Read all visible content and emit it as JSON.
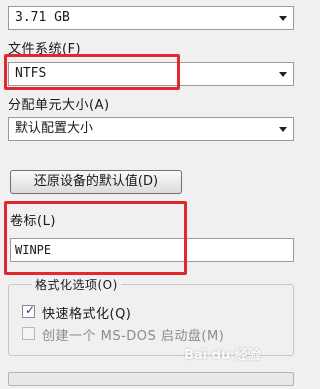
{
  "capacity": {
    "value": "3.71 GB"
  },
  "file_system": {
    "label": "文件系统(F)",
    "value": "NTFS"
  },
  "allocation": {
    "label": "分配单元大小(A)",
    "value": "默认配置大小"
  },
  "restore_button": {
    "label": "还原设备的默认值(D)"
  },
  "volume_label": {
    "label": "卷标(L)",
    "value": "WINPE"
  },
  "format_options": {
    "legend": "格式化选项(O)",
    "quick_format": {
      "label": "快速格式化(Q)",
      "checked": true
    },
    "msdos_disk": {
      "label": "创建一个 MS-DOS 启动盘(M)",
      "checked": false,
      "disabled": true
    }
  },
  "watermark": {
    "text": "Bai du 经验"
  },
  "colors": {
    "highlight": "#e0282e",
    "window_bg": "#f0f0f0"
  },
  "icons": [
    "dropdown-arrow-icon",
    "checkmark-icon"
  ]
}
